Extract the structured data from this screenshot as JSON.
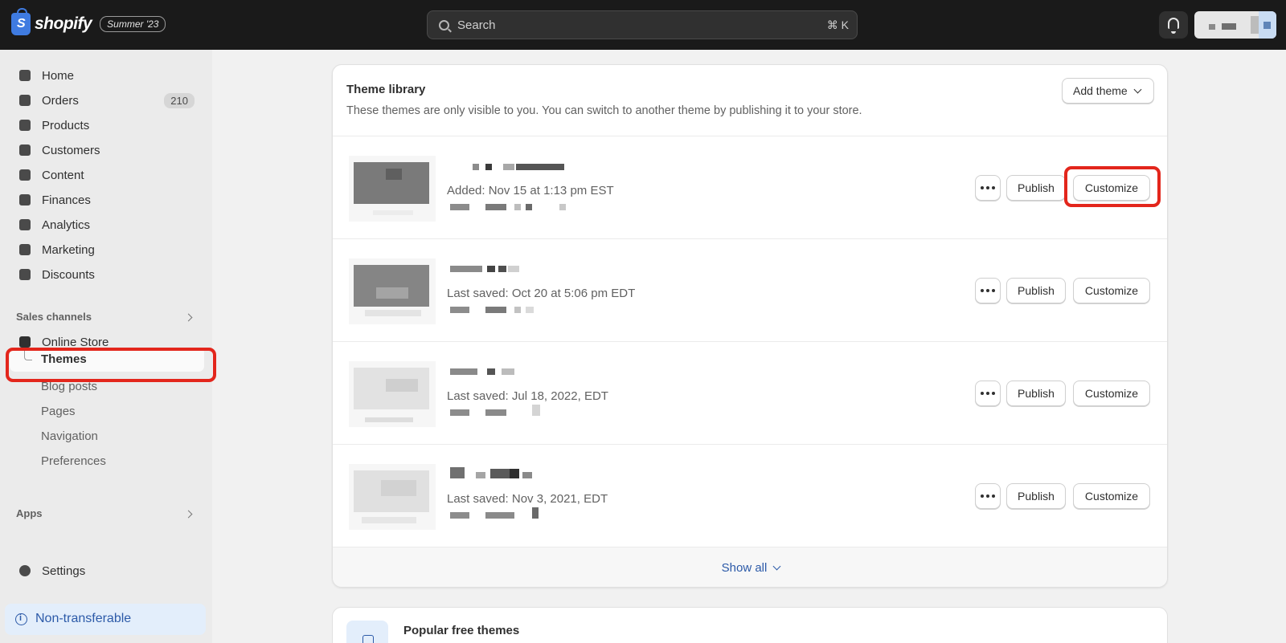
{
  "topbar": {
    "brand": "shopify",
    "brand_initial": "S",
    "edition": "Summer '23",
    "search_placeholder": "Search",
    "search_shortcut": "⌘ K"
  },
  "sidebar": {
    "items": [
      {
        "label": "Home",
        "icon": "home-icon"
      },
      {
        "label": "Orders",
        "icon": "orders-icon",
        "badge": "210"
      },
      {
        "label": "Products",
        "icon": "tag-icon"
      },
      {
        "label": "Customers",
        "icon": "person-icon"
      },
      {
        "label": "Content",
        "icon": "content-icon"
      },
      {
        "label": "Finances",
        "icon": "bank-icon"
      },
      {
        "label": "Analytics",
        "icon": "bar-chart-icon"
      },
      {
        "label": "Marketing",
        "icon": "target-icon"
      },
      {
        "label": "Discounts",
        "icon": "discount-icon"
      }
    ],
    "sales_channels_title": "Sales channels",
    "online_store": "Online Store",
    "subitems": [
      "Themes",
      "Blog posts",
      "Pages",
      "Navigation",
      "Preferences"
    ],
    "apps_title": "Apps",
    "settings": "Settings",
    "non_transferable": "Non-transferable"
  },
  "theme_library": {
    "title": "Theme library",
    "subtitle": "These themes are only visible to you. You can switch to another theme by publishing it to your store.",
    "add_theme": "Add theme",
    "themes": [
      {
        "date": "Added: Nov 15 at 1:13 pm EST"
      },
      {
        "date": "Last saved: Oct 20 at 5:06 pm EDT"
      },
      {
        "date": "Last saved: Jul 18, 2022, EDT"
      },
      {
        "date": "Last saved: Nov 3, 2021, EDT"
      }
    ],
    "publish_label": "Publish",
    "customize_label": "Customize",
    "show_all": "Show all"
  },
  "popular": {
    "title": "Popular free themes"
  },
  "colors": {
    "topbar": "#1a1a1a",
    "accent_blue": "#2c5aa8",
    "highlight_red": "#e3261c",
    "sidebar_bg": "#ebebeb"
  }
}
